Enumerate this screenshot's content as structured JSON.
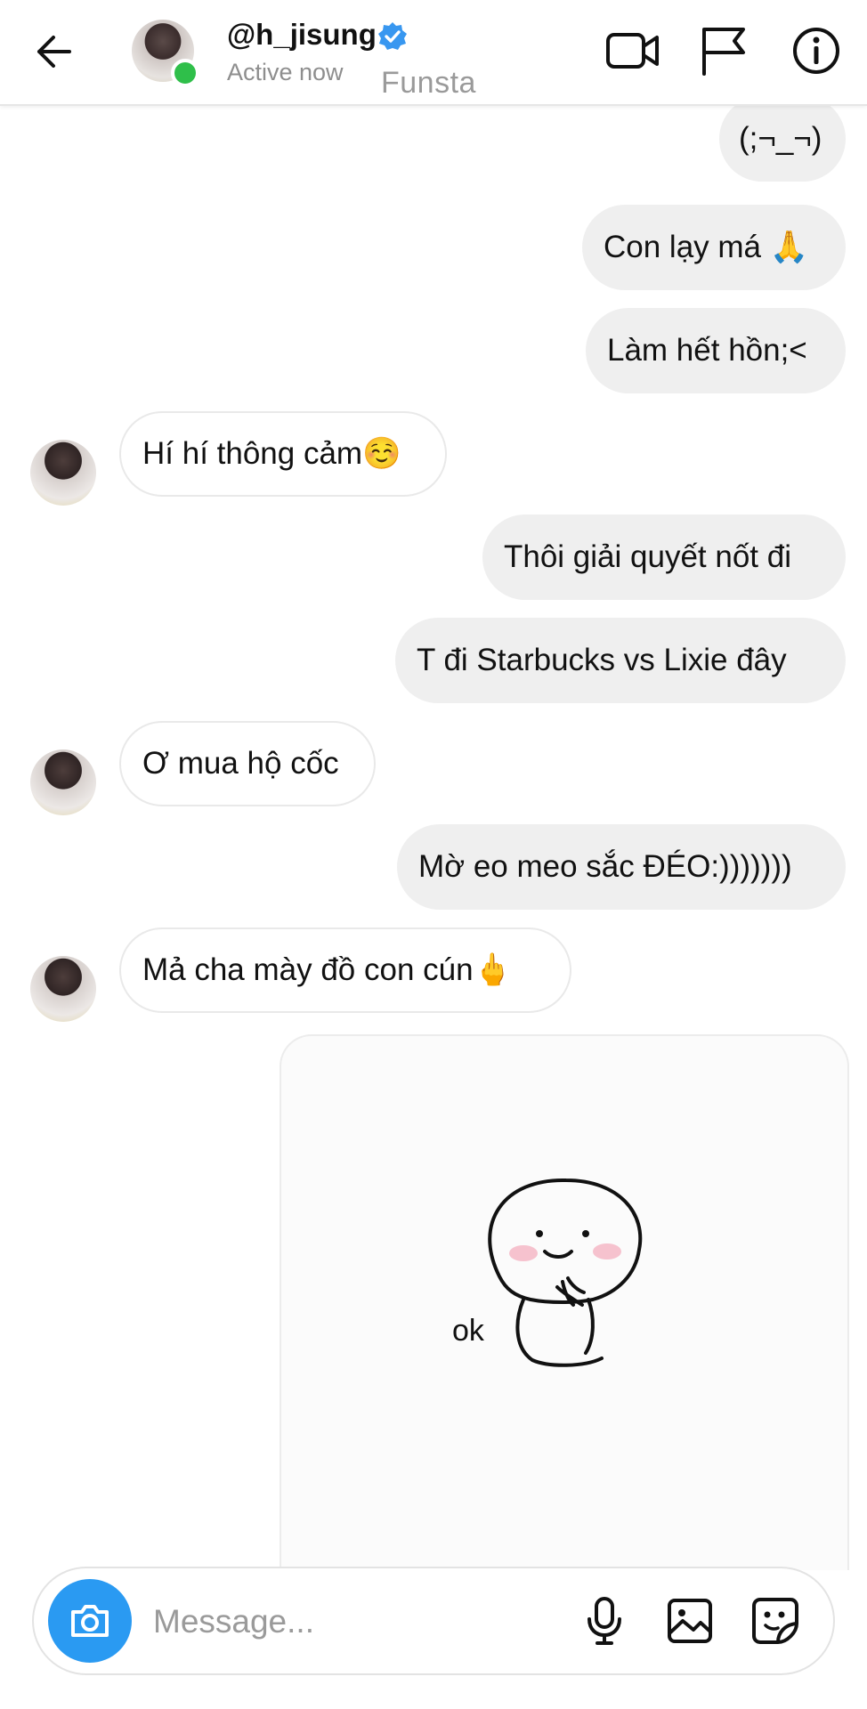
{
  "header": {
    "username": "@h_jisung",
    "status": "Active now",
    "tag": "Funsta",
    "icons": [
      "back-arrow-icon",
      "video-call-icon",
      "flag-icon",
      "info-icon"
    ]
  },
  "messages": [
    {
      "side": "sent",
      "text": "(;¬_¬)"
    },
    {
      "side": "sent",
      "text": "Con lạy má 🙏"
    },
    {
      "side": "sent",
      "text": "Làm hết hồn;<"
    },
    {
      "side": "received",
      "text": "Hí hí thông cảm☺️"
    },
    {
      "side": "sent",
      "text": "Thôi giải quyết nốt đi"
    },
    {
      "side": "sent",
      "text": "T đi Starbucks vs Lixie đây"
    },
    {
      "side": "received",
      "text": "Ơ mua hộ cốc"
    },
    {
      "side": "sent",
      "text": "Mờ eo meo sắc ĐÉO:)))))))"
    },
    {
      "side": "received",
      "text": "Mả cha mày đồ con cún🖕"
    }
  ],
  "sticker": {
    "text": "ok"
  },
  "composer": {
    "placeholder": "Message...",
    "value": "",
    "icons": [
      "camera-icon",
      "microphone-icon",
      "gallery-icon",
      "sticker-icon"
    ]
  },
  "colors": {
    "accent": "#2a9af2",
    "online": "#2fbf4a",
    "sent_bubble": "#efefef",
    "verified": "#3897f0"
  }
}
